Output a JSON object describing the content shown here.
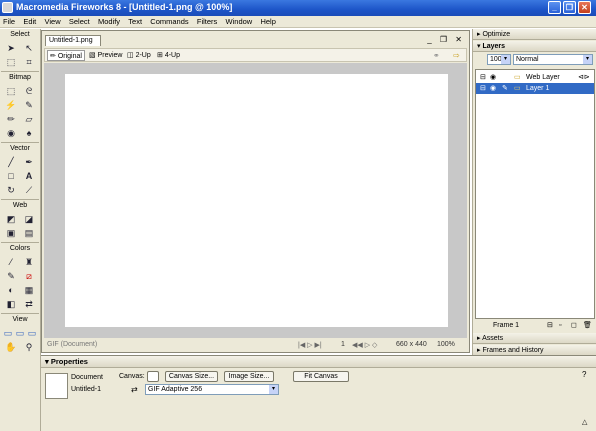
{
  "window": {
    "title": "Macromedia Fireworks 8 - [Untitled-1.png @ 100%]",
    "controls": [
      "_",
      "❐",
      "✕"
    ]
  },
  "menu": [
    "File",
    "Edit",
    "View",
    "Select",
    "Modify",
    "Text",
    "Commands",
    "Filters",
    "Window",
    "Help"
  ],
  "tools": {
    "sections": [
      "Select",
      "Bitmap",
      "Vector",
      "Web",
      "Colors",
      "View"
    ]
  },
  "document": {
    "tab": "Untitled-1.png",
    "views": [
      "Original",
      "Preview",
      "2-Up",
      "4-Up"
    ],
    "status": {
      "format": "GIF (Document)",
      "frame": "1",
      "size": "660 x 440",
      "zoom": "100%"
    }
  },
  "panels": {
    "optimize": "Optimize",
    "layers": {
      "title": "Layers",
      "opacity": "100",
      "blend": "Normal",
      "items": [
        "Web Layer",
        "Layer 1"
      ],
      "frame": "Frame 1"
    },
    "assets": "Assets",
    "frames_history": "Frames and History"
  },
  "properties": {
    "title": "Properties",
    "doc_label": "Document",
    "doc_name": "Untitled-1",
    "canvas_label": "Canvas:",
    "canvas_size_btn": "Canvas Size...",
    "image_size_btn": "Image Size...",
    "fit_canvas_btn": "Fit Canvas",
    "palette": "GIF Adaptive 256"
  }
}
